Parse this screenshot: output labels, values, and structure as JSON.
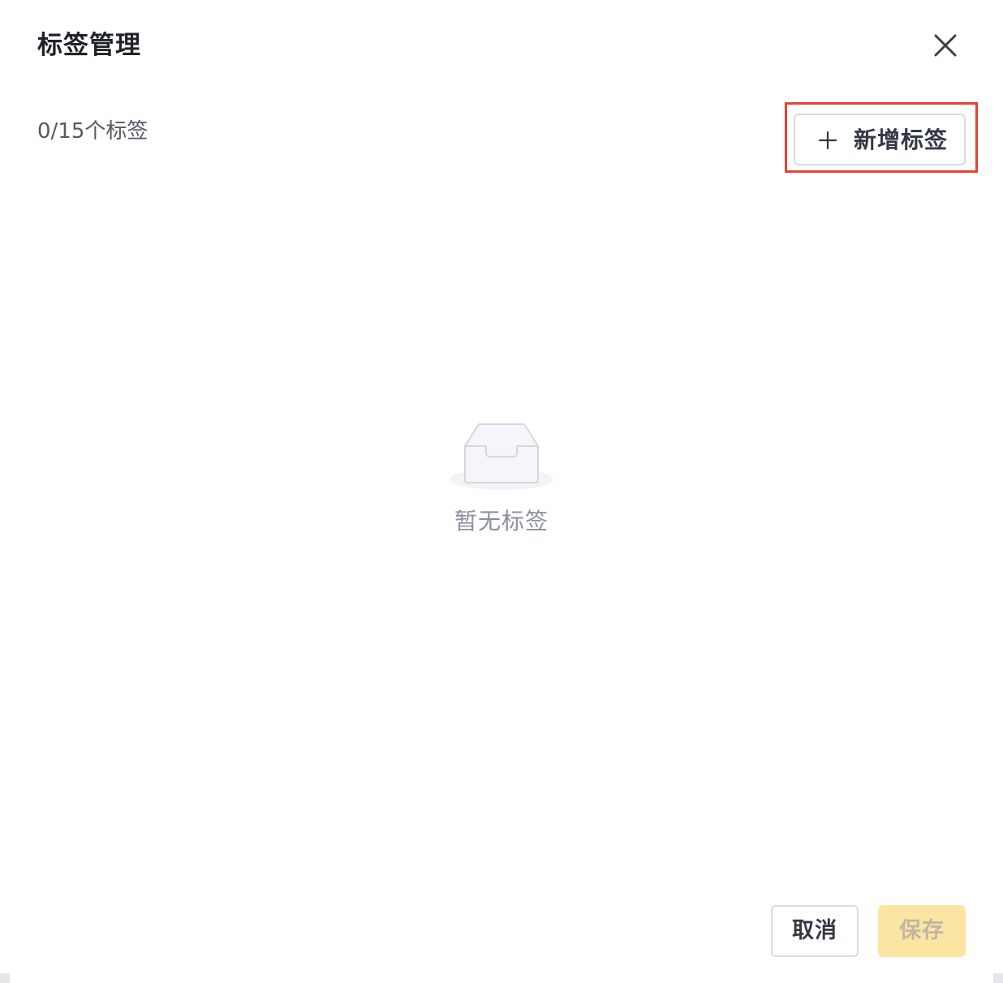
{
  "dialog": {
    "title": "标签管理",
    "close_icon": "close-icon"
  },
  "toolbar": {
    "count_text": "0/15个标签",
    "add_label": "新增标签",
    "add_icon": "plus-icon",
    "highlight_color": "#e8432e"
  },
  "empty_state": {
    "icon": "empty-inbox-icon",
    "text": "暂无标签"
  },
  "footer": {
    "cancel_label": "取消",
    "save_label": "保存",
    "save_disabled": true,
    "save_color": "#fbe5a3"
  }
}
